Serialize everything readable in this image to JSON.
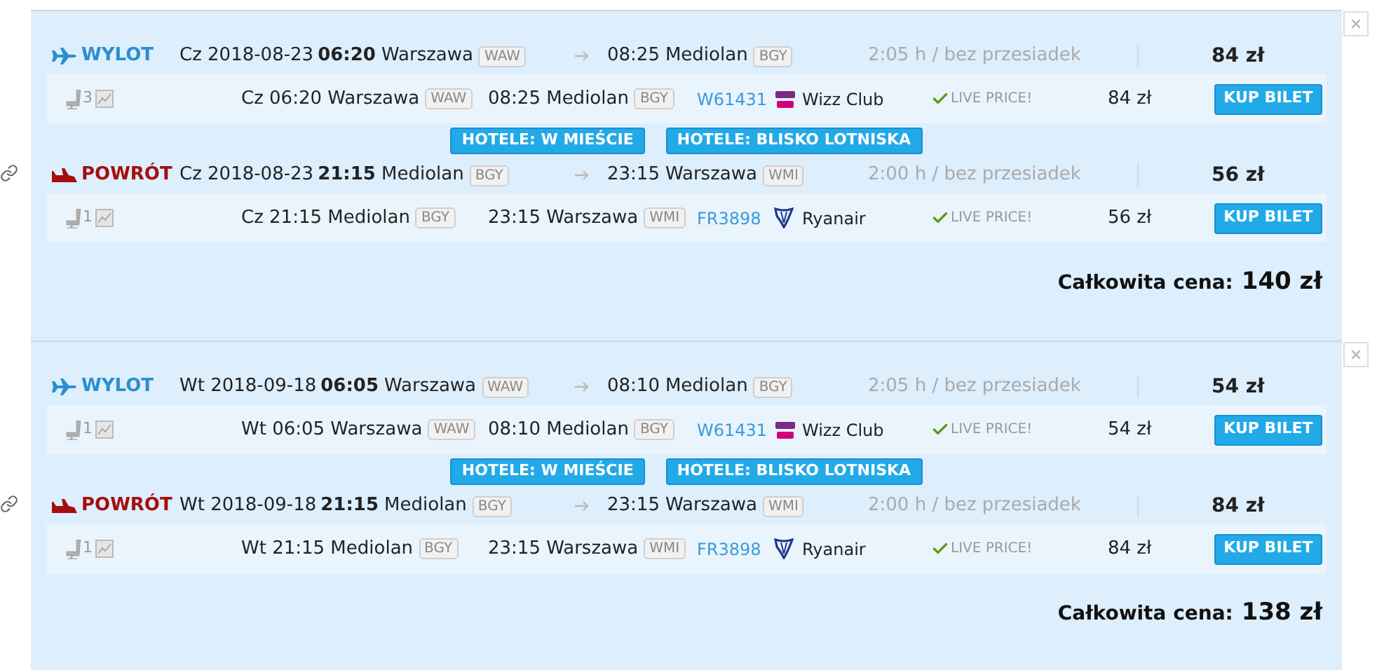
{
  "trips": [
    {
      "legs": [
        {
          "kind": "outbound",
          "label": "WYLOT",
          "date": "Cz 2018-08-23",
          "time": "06:20",
          "from_city": "Warszawa",
          "from_code": "WAW",
          "to_time": "08:25",
          "to_city": "Mediolan",
          "to_code": "BGY",
          "duration": "2:05 h / bez przesiadek",
          "price": "84 zł",
          "offer": {
            "seats": "3",
            "departure": "Cz 06:20 Warszawa",
            "departure_code": "WAW",
            "arrival": "08:25 Mediolan",
            "arrival_code": "BGY",
            "flight": "W61431",
            "airline": {
              "kind": "wizz",
              "name": "Wizz Club"
            },
            "status": "LIVE PRICE!",
            "price": "84 zł",
            "button": "KUP BILET"
          }
        },
        {
          "kind": "return",
          "label": "POWRÓT",
          "date": "Cz 2018-08-23",
          "time": "21:15",
          "from_city": "Mediolan",
          "from_code": "BGY",
          "to_time": "23:15",
          "to_city": "Warszawa",
          "to_code": "WMI",
          "duration": "2:00 h / bez przesiadek",
          "price": "56 zł",
          "offer": {
            "seats": "1",
            "departure": "Cz 21:15 Mediolan",
            "departure_code": "BGY",
            "arrival": "23:15 Warszawa",
            "arrival_code": "WMI",
            "flight": "FR3898",
            "airline": {
              "kind": "ryanair",
              "name": "Ryanair"
            },
            "status": "LIVE PRICE!",
            "price": "56 zł",
            "button": "KUP BILET"
          }
        }
      ],
      "hotel_buttons": [
        "HOTELE: W MIEŚCIE",
        "HOTELE: BLISKO LOTNISKA"
      ],
      "total_label": "Całkowita cena:",
      "total": "140 zł"
    },
    {
      "legs": [
        {
          "kind": "outbound",
          "label": "WYLOT",
          "date": "Wt 2018-09-18",
          "time": "06:05",
          "from_city": "Warszawa",
          "from_code": "WAW",
          "to_time": "08:10",
          "to_city": "Mediolan",
          "to_code": "BGY",
          "duration": "2:05 h / bez przesiadek",
          "price": "54 zł",
          "offer": {
            "seats": "1",
            "departure": "Wt 06:05 Warszawa",
            "departure_code": "WAW",
            "arrival": "08:10 Mediolan",
            "arrival_code": "BGY",
            "flight": "W61431",
            "airline": {
              "kind": "wizz",
              "name": "Wizz Club"
            },
            "status": "LIVE PRICE!",
            "price": "54 zł",
            "button": "KUP BILET"
          }
        },
        {
          "kind": "return",
          "label": "POWRÓT",
          "date": "Wt 2018-09-18",
          "time": "21:15",
          "from_city": "Mediolan",
          "from_code": "BGY",
          "to_time": "23:15",
          "to_city": "Warszawa",
          "to_code": "WMI",
          "duration": "2:00 h / bez przesiadek",
          "price": "84 zł",
          "offer": {
            "seats": "1",
            "departure": "Wt 21:15 Mediolan",
            "departure_code": "BGY",
            "arrival": "23:15 Warszawa",
            "arrival_code": "WMI",
            "flight": "FR3898",
            "airline": {
              "kind": "ryanair",
              "name": "Ryanair"
            },
            "status": "LIVE PRICE!",
            "price": "84 zł",
            "button": "KUP BILET"
          }
        }
      ],
      "hotel_buttons": [
        "HOTELE: W MIEŚCIE",
        "HOTELE: BLISKO LOTNISKA"
      ],
      "total_label": "Całkowita cena:",
      "total": "138 zł"
    }
  ]
}
